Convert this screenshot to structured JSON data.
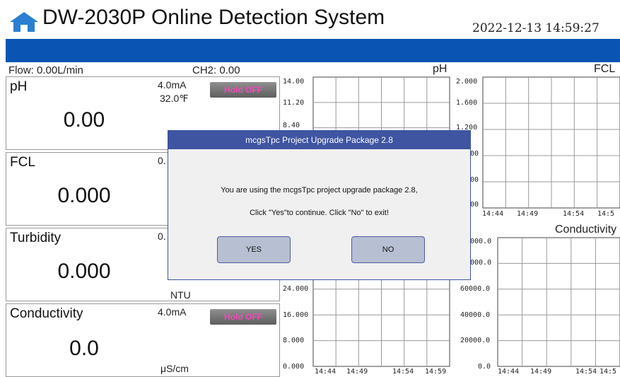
{
  "header": {
    "title": "DW-2030P Online Detection System",
    "datetime": "2022-12-13 14:59:27",
    "colors": {
      "bar": "#0a55b3",
      "home_icon": "#2a7fd4"
    }
  },
  "status": {
    "flow": "Flow: 0.00L/min",
    "ch2": "CH2: 0.00"
  },
  "panels": [
    {
      "name": "pH",
      "value": "0.00",
      "current": "4.0mA",
      "extra": "32.0℉",
      "hold": "Hold OFF"
    },
    {
      "name": "FCL",
      "value": "0.000",
      "current": "0."
    },
    {
      "name": "Turbidity",
      "value": "0.000",
      "current": "0.",
      "unit": "NTU"
    },
    {
      "name": "Conductivity",
      "value": "0.0",
      "current": "4.0mA",
      "hold": "Hold OFF",
      "unit": "μS/cm"
    }
  ],
  "charts": {
    "ph": {
      "title": "pH",
      "yticks": [
        "14.00",
        "11.20",
        "8.40"
      ]
    },
    "fcl": {
      "title": "FCL",
      "yticks": [
        "2.000",
        "1.600",
        "1.200",
        "00",
        "00",
        "00"
      ],
      "xticks": [
        "14:44",
        "14:49",
        "14:54",
        "14:5"
      ]
    },
    "turbidity": {
      "yticks": [
        "24.000",
        "16.000",
        "8.000",
        "0.000"
      ],
      "xticks": [
        "14:44",
        "14:49",
        "14:54",
        "14:59"
      ]
    },
    "conductivity": {
      "title": "Conductivity",
      "yticks": [
        "000.0",
        "000.0",
        "60000.0",
        "40000.0",
        "20000.0",
        "0.0"
      ],
      "xticks": [
        "14:44",
        "14:49",
        "14:54",
        "14:5"
      ]
    }
  },
  "dialog": {
    "title": "mcgsTpc Project Upgrade Package 2.8",
    "message1": "You are using the mcgsTpc project upgrade package 2.8,",
    "message2": "Click \"Yes\"to continue. Click \"No\" to exit!",
    "yes_label": "YES",
    "no_label": "NO"
  }
}
